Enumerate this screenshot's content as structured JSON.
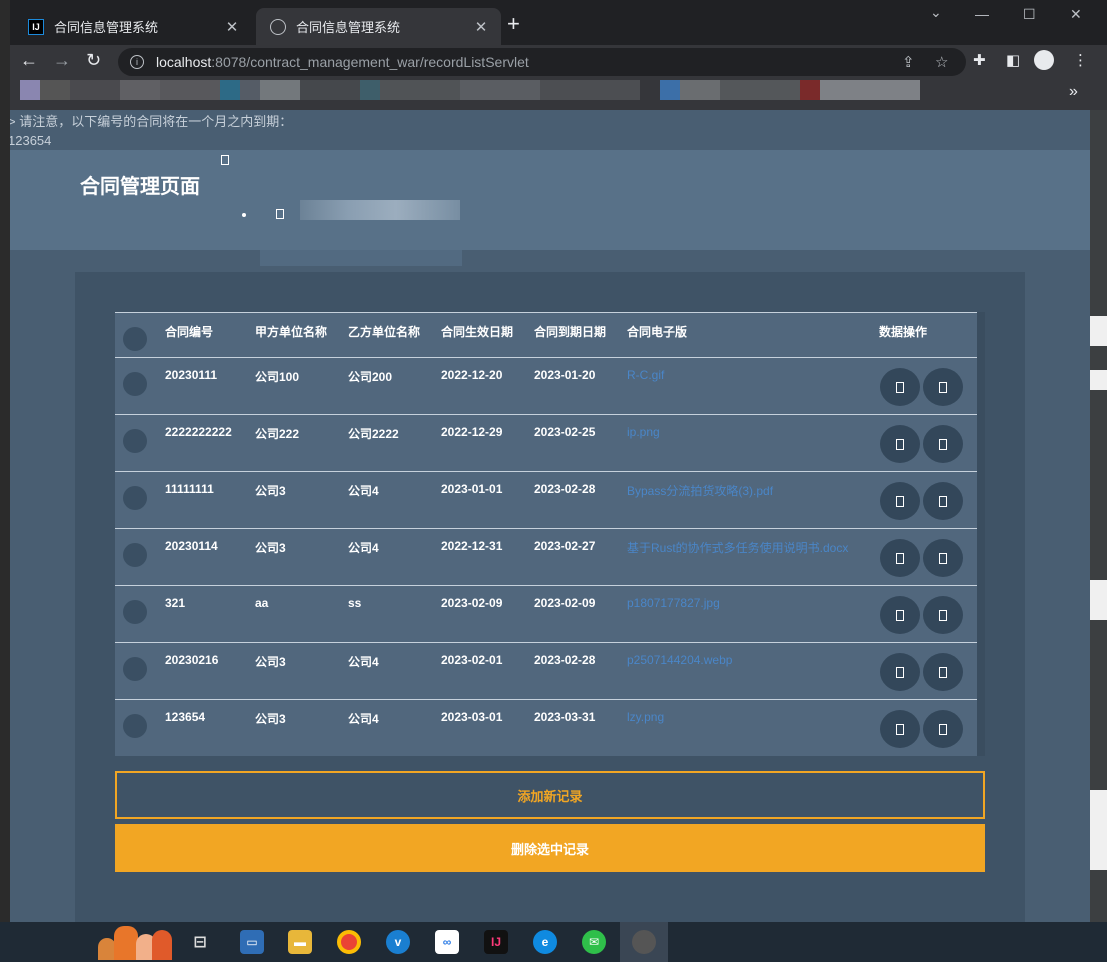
{
  "browser": {
    "tabs": [
      {
        "title": "合同信息管理系统",
        "active": false,
        "favicon": "intellij-icon"
      },
      {
        "title": "合同信息管理系统",
        "active": true,
        "favicon": "globe-icon"
      }
    ],
    "url_host": "localhost",
    "url_path": ":8078/contract_management_war/recordListServlet"
  },
  "notice": {
    "line1": "> 请注意，以下编号的合同将在一个月之内到期：",
    "line2": "123654"
  },
  "header": {
    "title": "合同管理页面"
  },
  "table": {
    "columns": [
      "合同编号",
      "甲方单位名称",
      "乙方单位名称",
      "合同生效日期",
      "合同到期日期",
      "合同电子版",
      "数据操作"
    ],
    "rows": [
      {
        "id": "20230111",
        "party_a": "公司100",
        "party_b": "公司200",
        "start": "2022-12-20",
        "end": "2023-01-20",
        "file": "R-C.gif"
      },
      {
        "id": "2222222222",
        "party_a": "公司222",
        "party_b": "公司2222",
        "start": "2022-12-29",
        "end": "2023-02-25",
        "file": "ip.png"
      },
      {
        "id": "11111111",
        "party_a": "公司3",
        "party_b": "公司4",
        "start": "2023-01-01",
        "end": "2023-02-28",
        "file": "Bypass分流拍货攻略(3).pdf"
      },
      {
        "id": "20230114",
        "party_a": "公司3",
        "party_b": "公司4",
        "start": "2022-12-31",
        "end": "2023-02-27",
        "file": "基于Rust的协作式多任务使用说明书.docx"
      },
      {
        "id": "321",
        "party_a": "aa",
        "party_b": "ss",
        "start": "2023-02-09",
        "end": "2023-02-09",
        "file": "p1807177827.jpg"
      },
      {
        "id": "20230216",
        "party_a": "公司3",
        "party_b": "公司4",
        "start": "2023-02-01",
        "end": "2023-02-28",
        "file": "p2507144204.webp"
      },
      {
        "id": "123654",
        "party_a": "公司3",
        "party_b": "公司4",
        "start": "2023-03-01",
        "end": "2023-03-31",
        "file": "lzy.png"
      }
    ]
  },
  "actions": {
    "add_label": "添加新记录",
    "delete_label": "删除选中记录"
  },
  "colors": {
    "accent": "#f2a623",
    "page_bg": "#495e72",
    "row_bg": "#51677d",
    "link": "#4a86c8"
  }
}
